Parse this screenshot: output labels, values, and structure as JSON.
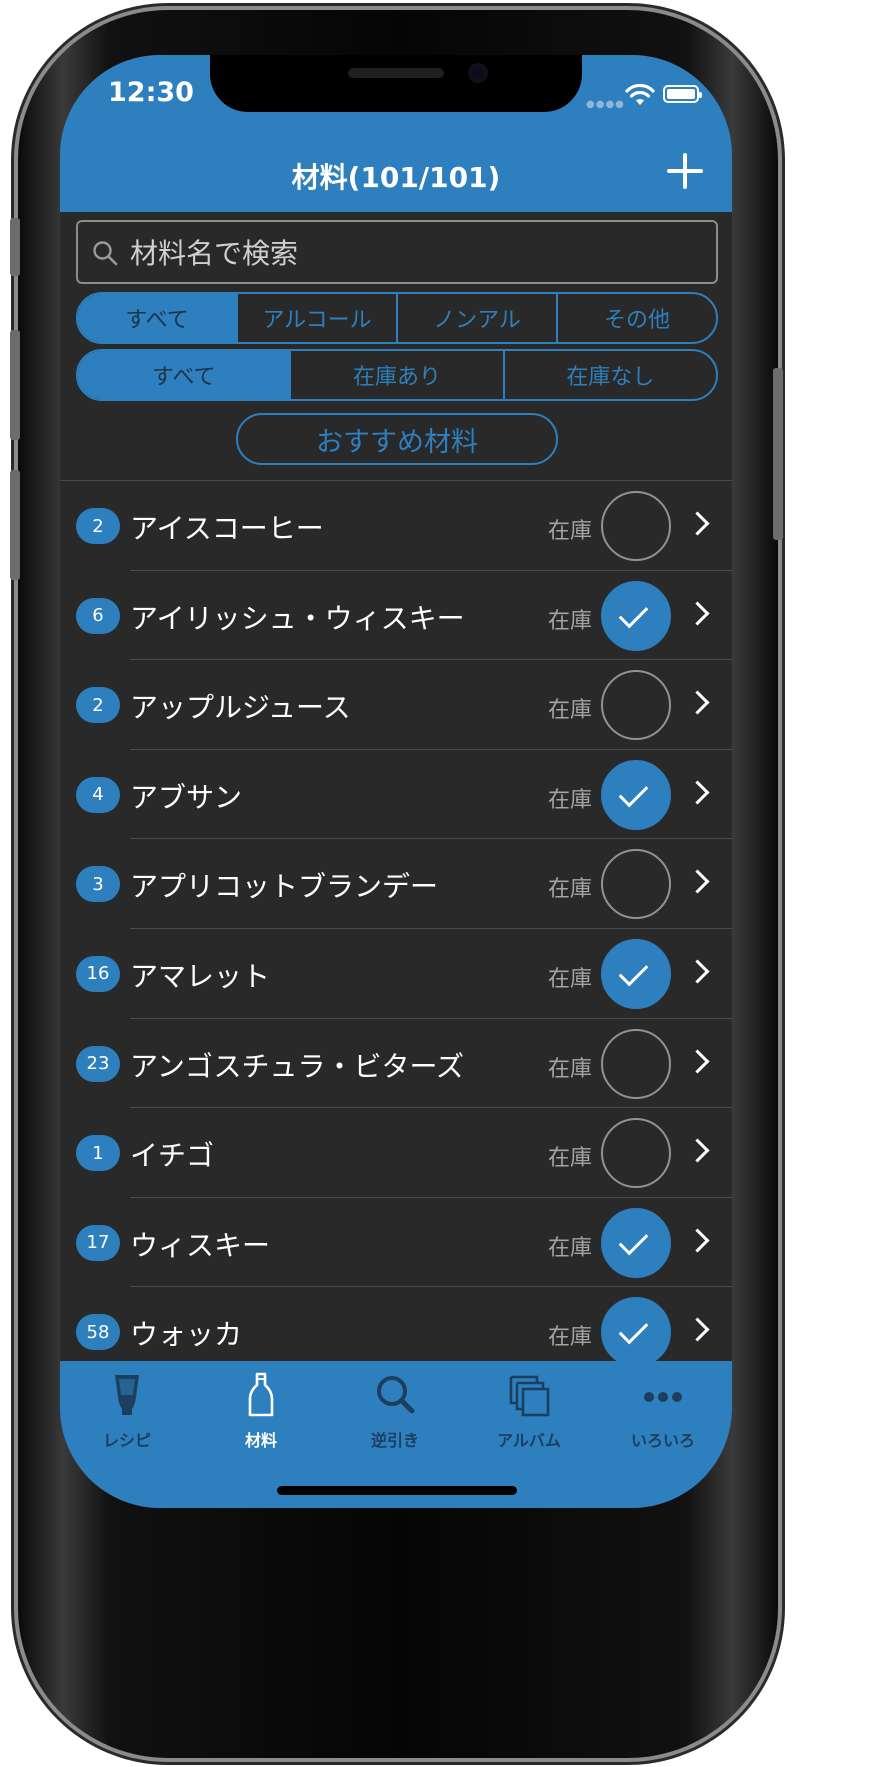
{
  "status_bar": {
    "time": "12:30"
  },
  "nav": {
    "title": "材料(101/101)",
    "add_icon": "plus-icon"
  },
  "search": {
    "placeholder": "材料名で検索",
    "value": ""
  },
  "category_filter": {
    "options": [
      "すべて",
      "アルコール",
      "ノンアル",
      "その他"
    ],
    "selected": "すべて"
  },
  "stock_filter": {
    "options": [
      "すべて",
      "在庫あり",
      "在庫なし"
    ],
    "selected": "すべて"
  },
  "recommend_button": {
    "label": "おすすめ材料"
  },
  "ingredients": [
    {
      "count": "2",
      "name": "アイスコーヒー",
      "stock_label": "在庫",
      "in_stock": false
    },
    {
      "count": "6",
      "name": "アイリッシュ・ウィスキー",
      "stock_label": "在庫",
      "in_stock": true
    },
    {
      "count": "2",
      "name": "アップルジュース",
      "stock_label": "在庫",
      "in_stock": false
    },
    {
      "count": "4",
      "name": "アブサン",
      "stock_label": "在庫",
      "in_stock": true
    },
    {
      "count": "3",
      "name": "アプリコットブランデー",
      "stock_label": "在庫",
      "in_stock": false
    },
    {
      "count": "16",
      "name": "アマレット",
      "stock_label": "在庫",
      "in_stock": true
    },
    {
      "count": "23",
      "name": "アンゴスチュラ・ビターズ",
      "stock_label": "在庫",
      "in_stock": false
    },
    {
      "count": "1",
      "name": "イチゴ",
      "stock_label": "在庫",
      "in_stock": false
    },
    {
      "count": "17",
      "name": "ウィスキー",
      "stock_label": "在庫",
      "in_stock": true
    },
    {
      "count": "58",
      "name": "ウォッカ",
      "stock_label": "在庫",
      "in_stock": true
    }
  ],
  "tab_bar": {
    "selected": "材料",
    "items": [
      {
        "label": "レシピ",
        "icon": "glass-icon"
      },
      {
        "label": "材料",
        "icon": "bottle-icon"
      },
      {
        "label": "逆引き",
        "icon": "search-icon"
      },
      {
        "label": "アルバム",
        "icon": "album-icon"
      },
      {
        "label": "いろいろ",
        "icon": "more-icon"
      }
    ]
  },
  "colors": {
    "accent": "#2d7fbe",
    "background": "#292929",
    "separator": "#4c4c4c",
    "tab_inactive": "#1d3e5e"
  }
}
